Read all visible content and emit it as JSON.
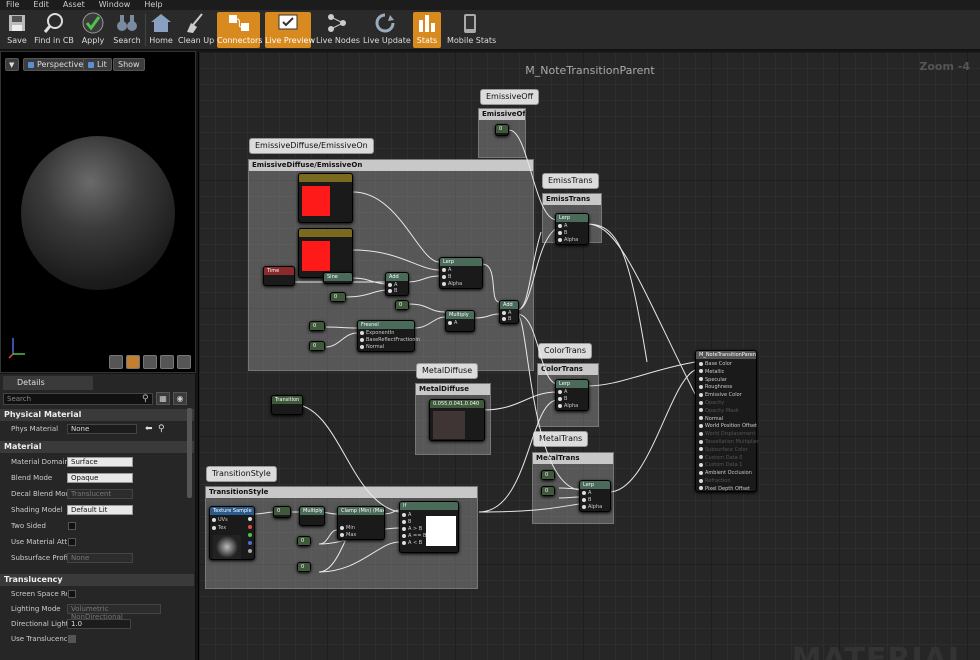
{
  "menu": [
    "File",
    "Edit",
    "Asset",
    "Window",
    "Help"
  ],
  "toolbar": [
    {
      "label": "Save",
      "icon": "save-icon"
    },
    {
      "label": "Find in CB",
      "icon": "search-icon"
    },
    {
      "label": "Apply",
      "icon": "checkmark-icon"
    },
    {
      "label": "Search",
      "icon": "binoculars-icon"
    },
    {
      "label": "Home",
      "icon": "home-icon"
    },
    {
      "label": "Clean Up",
      "icon": "broom-icon"
    },
    {
      "label": "Connectors",
      "icon": "connectors-icon",
      "active": true
    },
    {
      "label": "Live Preview",
      "icon": "live-preview-icon",
      "active": true
    },
    {
      "label": "Live Nodes",
      "icon": "live-nodes-icon"
    },
    {
      "label": "Live Update",
      "icon": "live-update-icon"
    },
    {
      "label": "Stats",
      "icon": "stats-icon",
      "active": true
    },
    {
      "label": "Mobile Stats",
      "icon": "mobile-stats-icon"
    }
  ],
  "viewport": {
    "perspective": "Perspective",
    "lit": "Lit",
    "show": "Show"
  },
  "details": {
    "tab": "Details",
    "search_placeholder": "Search",
    "physical_material": "Physical Material",
    "phys_material_label": "Phys Material",
    "phys_material_value": "None",
    "material": "Material",
    "rows": [
      {
        "label": "Material Domain",
        "value": "Surface",
        "kind": "dd"
      },
      {
        "label": "Blend Mode",
        "value": "Opaque",
        "kind": "dd"
      },
      {
        "label": "Decal Blend Mode",
        "value": "Translucent",
        "kind": "dis"
      },
      {
        "label": "Shading Model",
        "value": "Default Lit",
        "kind": "dd"
      },
      {
        "label": "Two Sided",
        "value": "",
        "kind": "chk"
      },
      {
        "label": "Use Material Attributes",
        "value": "",
        "kind": "chk"
      },
      {
        "label": "Subsurface Profile",
        "value": "None",
        "kind": "dis"
      }
    ],
    "translucency": "Translucency",
    "trows": [
      {
        "label": "Screen Space Reflections",
        "value": "",
        "kind": "chk"
      },
      {
        "label": "Lighting Mode",
        "value": "Volumetric NonDirectional",
        "kind": "dis"
      },
      {
        "label": "Directional Lighting Intensity",
        "value": "1.0",
        "kind": "num"
      },
      {
        "label": "Use Translucency Vertex Fog",
        "value": "",
        "kind": "chkon"
      }
    ]
  },
  "graph": {
    "title": "M_NoteTransitionParent",
    "zoom": "Zoom -4",
    "watermark": "MATERIAL",
    "comments": {
      "emissive_off": "EmissiveOff",
      "emissive_diffuse": "EmissiveDiffuse/EmissiveOn",
      "emiss_trans": "EmissTrans",
      "color_trans": "ColorTrans",
      "metal_diffuse": "MetalDiffuse",
      "metal_trans": "MetalTrans",
      "transition_style": "TransitionStyle"
    },
    "nodes": {
      "lerp": "Lerp",
      "add": "Add",
      "multiply": "Multiply",
      "fresnel": "Fresnel",
      "time": "Time",
      "sine": "Sine",
      "transition": "Transition",
      "texture_sample": "Texture Sample",
      "clamp": "Clamp (Min) (Max)",
      "if": "If",
      "metal_value": "0.055,0.041,0.040",
      "pin_a": "A",
      "pin_b": "B",
      "pin_alpha": "Alpha",
      "pin_min": "Min",
      "pin_max": "Max",
      "pin_uvs": "UVs",
      "pin_tex": "Tex",
      "pin_exponent": "ExponentIn",
      "pin_base_reflect": "BaseReflectFractionIn",
      "pin_normal": "Normal",
      "pin_agb": "A > B",
      "pin_aeb": "A == B",
      "pin_alb": "A < B",
      "const_label": "0"
    },
    "result": {
      "title": "M_NoteTransitionParent",
      "pins": [
        "Base Color",
        "Metallic",
        "Specular",
        "Roughness",
        "Emissive Color",
        "Opacity",
        "Opacity Mask",
        "Normal",
        "World Position Offset",
        "World Displacement",
        "Tessellation Multiplier",
        "Subsurface Color",
        "Custom Data 0",
        "Custom Data 1",
        "Ambient Occlusion",
        "Refraction",
        "Pixel Depth Offset"
      ],
      "active": [
        true,
        true,
        true,
        true,
        true,
        false,
        false,
        true,
        true,
        false,
        false,
        false,
        false,
        false,
        true,
        false,
        true
      ]
    }
  }
}
